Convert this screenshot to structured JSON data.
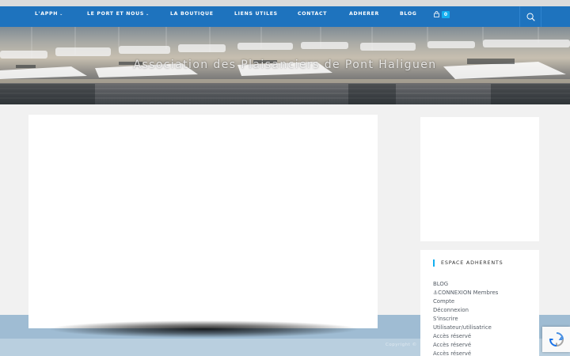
{
  "nav": {
    "items": [
      {
        "label": "L'APPH",
        "dropdown": true
      },
      {
        "label": "LE PORT ET NOUS",
        "dropdown": true
      },
      {
        "label": "LA BOUTIQUE",
        "dropdown": false
      },
      {
        "label": "LIENS UTILES",
        "dropdown": false
      },
      {
        "label": "CONTACT",
        "dropdown": false
      },
      {
        "label": "ADHERER",
        "dropdown": false
      },
      {
        "label": "BLOG",
        "dropdown": false
      }
    ],
    "cart_count": "0",
    "chevron": "⌄"
  },
  "hero": {
    "title": "Association des Plaisanciers de Pont Haliguen"
  },
  "sidebar": {
    "section_title": "ESPACE ADHERENTS",
    "links": [
      "BLOG",
      "⚓CONNEXION Membres",
      "Compte",
      "Déconnexion",
      "S'inscrire",
      "Utilisateur/utilisatrice",
      "Accès réservé",
      "Accès réservé",
      "Accès réservé"
    ]
  },
  "footer": {
    "text": "Copyright ©"
  },
  "colors": {
    "nav_bg": "#1e73be",
    "accent": "#13aff0",
    "page_bg": "#f1f1f1"
  },
  "icons": {
    "cart": "cart-icon",
    "search": "search-icon",
    "chevron": "chevron-down-icon",
    "recaptcha": "recaptcha-icon"
  }
}
